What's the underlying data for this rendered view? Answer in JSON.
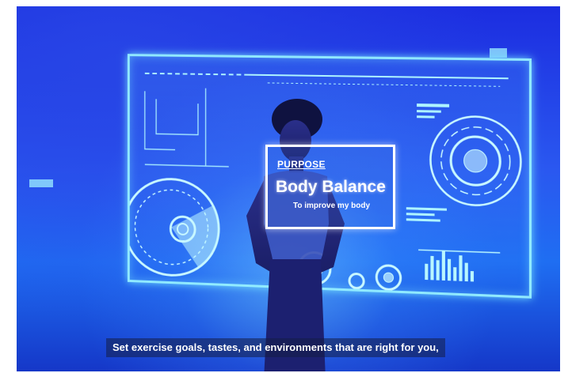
{
  "scene": {
    "overlay": {
      "heading": "PURPOSE",
      "title": "Body Balance",
      "subtitle": "To improve my body"
    },
    "caption": "Set exercise goals, tastes, and environments that are right for you,"
  },
  "colors": {
    "background_blue": "#1f4ae8",
    "hud_cyan": "#96f0ff",
    "overlay_border": "#ffffff"
  }
}
